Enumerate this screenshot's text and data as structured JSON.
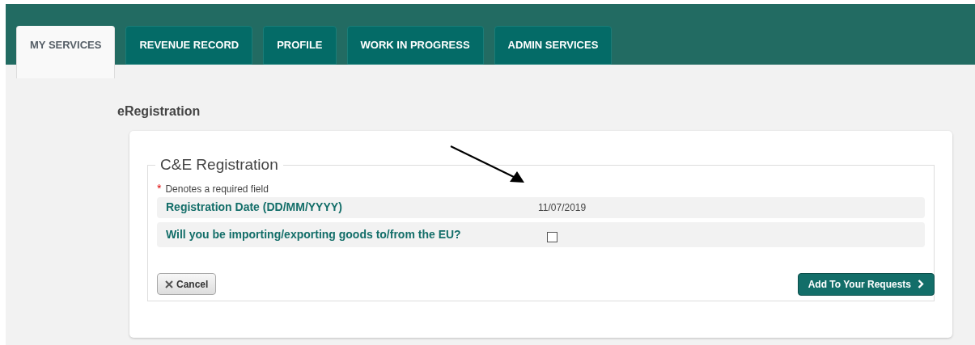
{
  "tabs": [
    {
      "label": "MY SERVICES",
      "selected": true
    },
    {
      "label": "REVENUE RECORD",
      "selected": false
    },
    {
      "label": "PROFILE",
      "selected": false
    },
    {
      "label": "WORK IN PROGRESS",
      "selected": false
    },
    {
      "label": "ADMIN SERVICES",
      "selected": false
    }
  ],
  "page_title": "eRegistration",
  "form": {
    "legend": "C&E Registration",
    "required_mark": "*",
    "required_note": "Denotes a required field",
    "rows": [
      {
        "kind": "text",
        "label": "Registration Date (DD/MM/YYYY)",
        "value": "11/07/2019"
      },
      {
        "kind": "checkbox",
        "label": "Will you be importing/exporting goods to/from the EU?",
        "checked": false
      }
    ],
    "cancel": "Cancel",
    "submit": "Add To Your Requests"
  }
}
